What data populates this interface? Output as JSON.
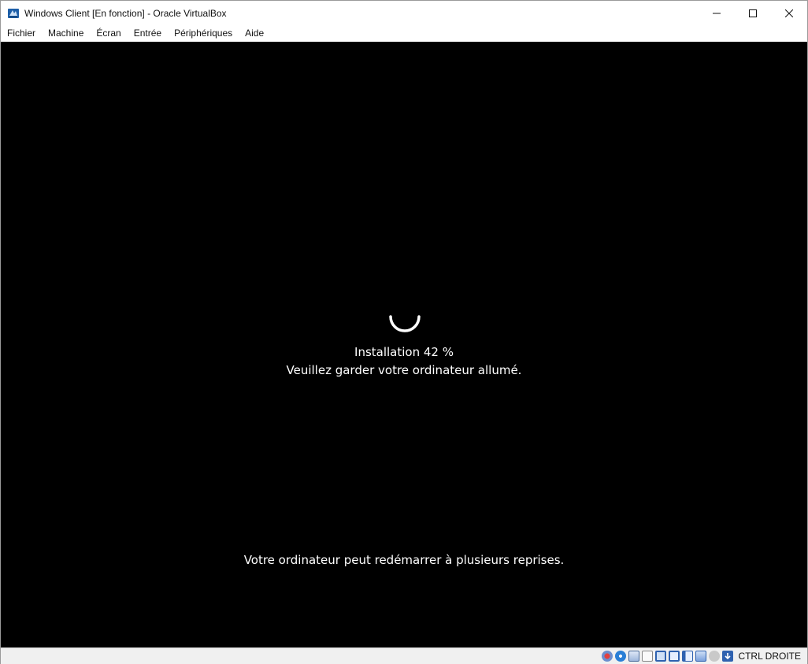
{
  "window": {
    "title": "Windows Client [En fonction] - Oracle VirtualBox",
    "icon": "virtualbox-app-icon",
    "controls": [
      "minimize-icon",
      "maximize-icon",
      "close-icon"
    ]
  },
  "menubar": {
    "items": [
      {
        "label": "Fichier"
      },
      {
        "label": "Machine"
      },
      {
        "label": "Écran"
      },
      {
        "label": "Entrée"
      },
      {
        "label": "Périphériques"
      },
      {
        "label": "Aide"
      }
    ]
  },
  "guest_screen": {
    "progress_text": "Installation 42 %",
    "progress_percent": 42,
    "keep_on_text": "Veuillez garder votre ordinateur allumé.",
    "restart_text": "Votre ordinateur peut redémarrer à plusieurs reprises.",
    "background_color": "#000000",
    "text_color": "#ffffff"
  },
  "statusbar": {
    "icons": [
      "hard-disk-icon",
      "optical-drive-icon",
      "audio-icon",
      "network-icon",
      "usb-icon",
      "shared-folders-icon",
      "display-icon",
      "recording-icon",
      "cpu-icon",
      "mouse-integration-icon"
    ],
    "host_key": "CTRL DROITE"
  }
}
